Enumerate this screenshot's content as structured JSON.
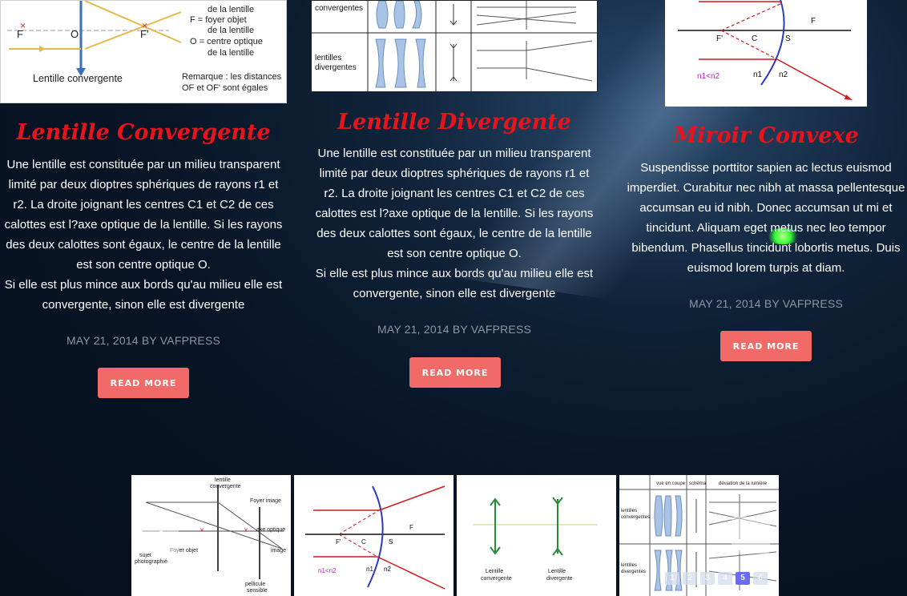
{
  "posts": [
    {
      "title": "Lentille Convergente",
      "paragraphs": [
        "Une lentille est constituée par un milieu transparent limité par deux dioptres sphériques de rayons r1 et r2. La droite joignant les centres C1 et C2 de ces calottes est l?axe optique de la lentille. Si les rayons des deux calottes sont égaux, le centre de la lentille est son centre optique O.",
        "Si elle est plus mince aux bords qu'au milieu elle est convergente, sinon elle est divergente"
      ],
      "meta": "MAY 21, 2014 BY VAFPRESS",
      "button": "READ MORE",
      "image": {
        "legend_lines": [
          "de la lentille",
          "F = foyer objet",
          "de la lentille",
          "O = centre optique",
          "de la lentille"
        ],
        "point_f": "F",
        "point_o": "O",
        "point_f_prime": "F'",
        "caption": "Lentille convergente",
        "remark_lines": [
          "Remarque : les distances",
          "OF et OF' sont égales"
        ]
      }
    },
    {
      "title": "Lentille Divergente",
      "paragraphs": [
        "Une lentille est constituée par un milieu transparent limité par deux dioptres sphériques de rayons r1 et r2. La droite joignant les centres C1 et C2 de ces calottes est l?axe optique de la lentille. Si les rayons des deux calottes sont égaux, le centre de la lentille est son centre optique O.",
        "Si elle est plus mince aux bords qu'au milieu elle est convergente, sinon elle est divergente"
      ],
      "meta": "MAY 21, 2014 BY VAFPRESS",
      "button": "READ MORE",
      "image": {
        "row1_label": "convergentes",
        "row2_label_lines": [
          "lentilles",
          "divergentes"
        ]
      }
    },
    {
      "title": "Miroir Convexe",
      "paragraphs": [
        "Suspendisse porttitor sapien ac lectus euismod imperdiet. Curabitur nec nibh at massa pellentesque accumsan eu id nibh. Donec accumsan ut mi et tincidunt. Aliquam eget metus nec leo tempor bibendum. Phasellus tincidunt lobortis metus. Duis euismod lorem turpis at diam."
      ],
      "meta": "MAY 21, 2014 BY VAFPRESS",
      "button": "READ MORE",
      "image": {
        "f_prime": "F'",
        "c": "C",
        "s": "S",
        "f": "F",
        "n_relation": "n1<n2",
        "n1": "n1",
        "n2": "n2"
      }
    }
  ],
  "carousel": {
    "slide1": {
      "labels": [
        "lentille",
        "convergente",
        "Foyer image",
        "axe optique",
        "image",
        "Foyer objet",
        "sujet",
        "photographié",
        "pellicule",
        "sensible"
      ]
    },
    "slide2": {
      "f_prime": "F'",
      "c": "C",
      "s": "S",
      "f": "F",
      "n_relation": "n1<n2",
      "n1": "n1",
      "n2": "n2"
    },
    "slide3": {
      "left_lines": [
        "Lentille",
        "convergente"
      ],
      "right_lines": [
        "Lentille",
        "divergente"
      ]
    },
    "slide4": {
      "headers": [
        "vue en coupe",
        "schéma",
        "déviation de la lumière"
      ],
      "row1_lines": [
        "lentilles",
        "convergentes"
      ],
      "row2_lines": [
        "lentilles",
        "divergentes"
      ]
    },
    "prev_glyph": "‹",
    "next_glyph": "›",
    "pages": [
      "1",
      "2",
      "3",
      "4",
      "5",
      "6"
    ],
    "active_page": "5"
  },
  "colors": {
    "title_red": "#e8141b",
    "button_coral": "#f26a68",
    "meta_gray": "#8d96a3",
    "active_dot": "#6a6cf0"
  }
}
